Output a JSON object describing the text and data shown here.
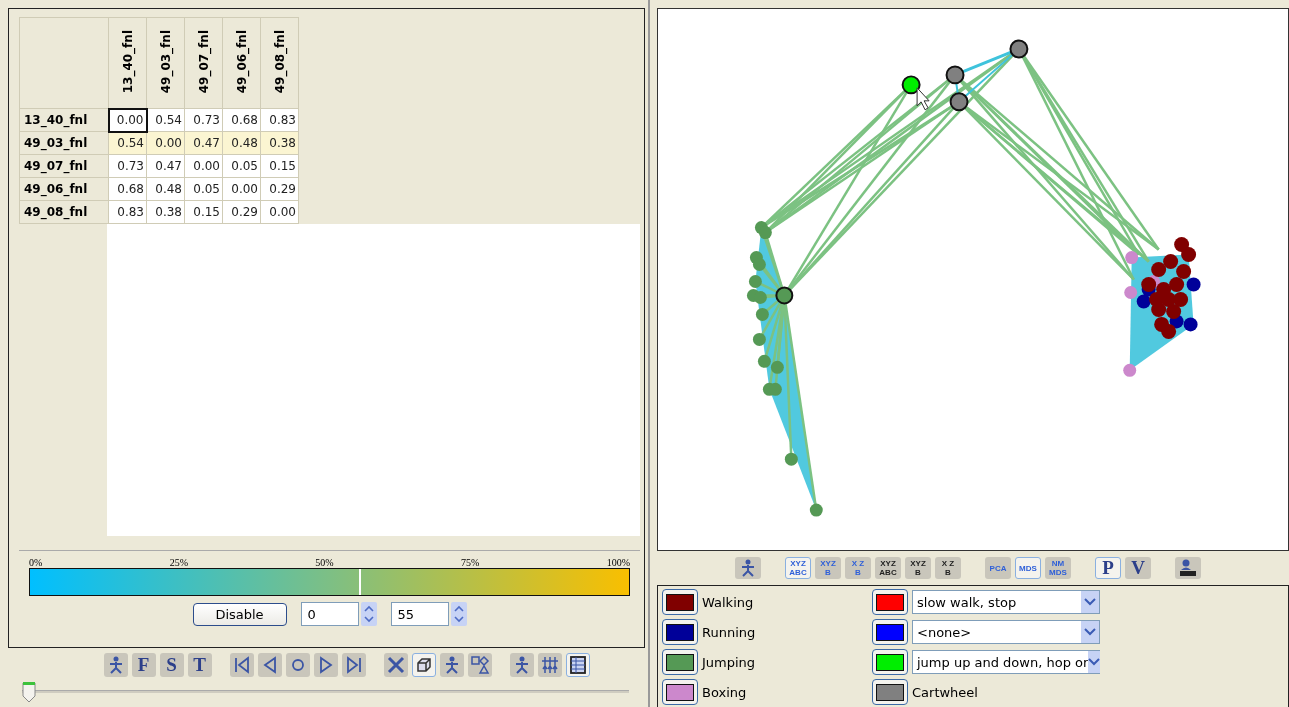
{
  "matrix": {
    "columns": [
      "13_40_fnl",
      "49_03_fnl",
      "49_07_fnl",
      "49_06_fnl",
      "49_08_fnl"
    ],
    "rows": [
      {
        "label": "13_40_fnl",
        "selected": false,
        "cells": [
          {
            "value": "0.00",
            "focused": true
          },
          {
            "value": "0.54",
            "focused": false
          },
          {
            "value": "0.73",
            "focused": false
          },
          {
            "value": "0.68",
            "focused": false
          },
          {
            "value": "0.83",
            "focused": false
          }
        ]
      },
      {
        "label": "49_03_fnl",
        "selected": true,
        "cells": [
          {
            "value": "0.54",
            "focused": false
          },
          {
            "value": "0.00",
            "focused": false
          },
          {
            "value": "0.47",
            "focused": false
          },
          {
            "value": "0.48",
            "focused": false
          },
          {
            "value": "0.38",
            "focused": false
          }
        ]
      },
      {
        "label": "49_07_fnl",
        "selected": false,
        "cells": [
          {
            "value": "0.73",
            "focused": false
          },
          {
            "value": "0.47",
            "focused": false
          },
          {
            "value": "0.00",
            "focused": false
          },
          {
            "value": "0.05",
            "focused": false
          },
          {
            "value": "0.15",
            "focused": false
          }
        ]
      },
      {
        "label": "49_06_fnl",
        "selected": false,
        "cells": [
          {
            "value": "0.68",
            "focused": false
          },
          {
            "value": "0.48",
            "focused": false
          },
          {
            "value": "0.05",
            "focused": false
          },
          {
            "value": "0.00",
            "focused": false
          },
          {
            "value": "0.29",
            "focused": false
          }
        ]
      },
      {
        "label": "49_08_fnl",
        "selected": false,
        "cells": [
          {
            "value": "0.83",
            "focused": false
          },
          {
            "value": "0.38",
            "focused": false
          },
          {
            "value": "0.15",
            "focused": false
          },
          {
            "value": "0.29",
            "focused": false
          },
          {
            "value": "0.00",
            "focused": false
          }
        ]
      }
    ]
  },
  "color_scale": {
    "ticks": [
      "0%",
      "25%",
      "50%",
      "75%",
      "100%"
    ],
    "level": 0.55,
    "button": "Disable",
    "min": "0",
    "max": "55"
  },
  "left_toolbar": [
    [
      {
        "kind": "figure",
        "selected": false
      },
      {
        "kind": "letter",
        "text": "F",
        "selected": false
      },
      {
        "kind": "letter",
        "text": "S",
        "selected": false
      },
      {
        "kind": "letter",
        "text": "T",
        "selected": false
      }
    ],
    [
      {
        "kind": "first",
        "selected": false
      },
      {
        "kind": "prev",
        "selected": false
      },
      {
        "kind": "stop",
        "selected": false
      },
      {
        "kind": "next",
        "selected": false
      },
      {
        "kind": "last",
        "selected": false
      }
    ],
    [
      {
        "kind": "cross",
        "selected": false
      },
      {
        "kind": "cube",
        "selected": true
      },
      {
        "kind": "figure",
        "selected": false
      },
      {
        "kind": "shapes",
        "selected": false
      }
    ],
    [
      {
        "kind": "figure",
        "selected": false
      },
      {
        "kind": "figures",
        "selected": false
      },
      {
        "kind": "grid",
        "selected": true
      }
    ]
  ],
  "timeline": {
    "level": 0
  },
  "right_toolbar": [
    [
      {
        "kind": "figure",
        "selected": false
      }
    ],
    [
      {
        "kind": "glyph",
        "lines": [
          "XYZ",
          "ABC"
        ],
        "color": "#2e5fd8",
        "selected": true
      },
      {
        "kind": "glyph",
        "lines": [
          "XYZ",
          "B"
        ],
        "color": "#2e5fd8",
        "selected": false
      },
      {
        "kind": "glyph",
        "lines": [
          "X Z",
          "B"
        ],
        "color": "#2e5fd8",
        "selected": false
      },
      {
        "kind": "glyph",
        "lines": [
          "XYZ",
          "ABC"
        ],
        "color": "#222222",
        "selected": false
      },
      {
        "kind": "glyph",
        "lines": [
          "XYZ",
          "B"
        ],
        "color": "#222222",
        "selected": false
      },
      {
        "kind": "glyph",
        "lines": [
          "X Z",
          "B"
        ],
        "color": "#222222",
        "selected": false
      }
    ],
    [
      {
        "kind": "glyph",
        "lines": [
          "PCA"
        ],
        "color": "#2e5fd8",
        "selected": false
      },
      {
        "kind": "glyph",
        "lines": [
          "MDS"
        ],
        "color": "#2e5fd8",
        "selected": true
      },
      {
        "kind": "glyph",
        "lines": [
          "NM",
          "MDS"
        ],
        "color": "#2e5fd8",
        "selected": false
      }
    ],
    [
      {
        "kind": "letter",
        "text": "P",
        "selected": true
      },
      {
        "kind": "letter",
        "text": "V",
        "selected": false
      }
    ],
    [
      {
        "kind": "keyboard",
        "selected": false
      }
    ]
  ],
  "legend": [
    {
      "left": {
        "label": "Walking",
        "color": "#800000"
      },
      "right": {
        "kind": "dropdown",
        "color": "#ff0000",
        "value": "slow walk, stop"
      }
    },
    {
      "left": {
        "label": "Running",
        "color": "#000099"
      },
      "right": {
        "kind": "dropdown",
        "color": "#0000ff",
        "value": "<none>"
      }
    },
    {
      "left": {
        "label": "Jumping",
        "color": "#559955"
      },
      "right": {
        "kind": "dropdown",
        "color": "#00ee00",
        "value": "jump up and down, hop or"
      }
    },
    {
      "left": {
        "label": "Boxing",
        "color": "#cc88cc"
      },
      "right": {
        "kind": "label",
        "color": "#808080",
        "label": "Cartwheel"
      }
    }
  ]
}
